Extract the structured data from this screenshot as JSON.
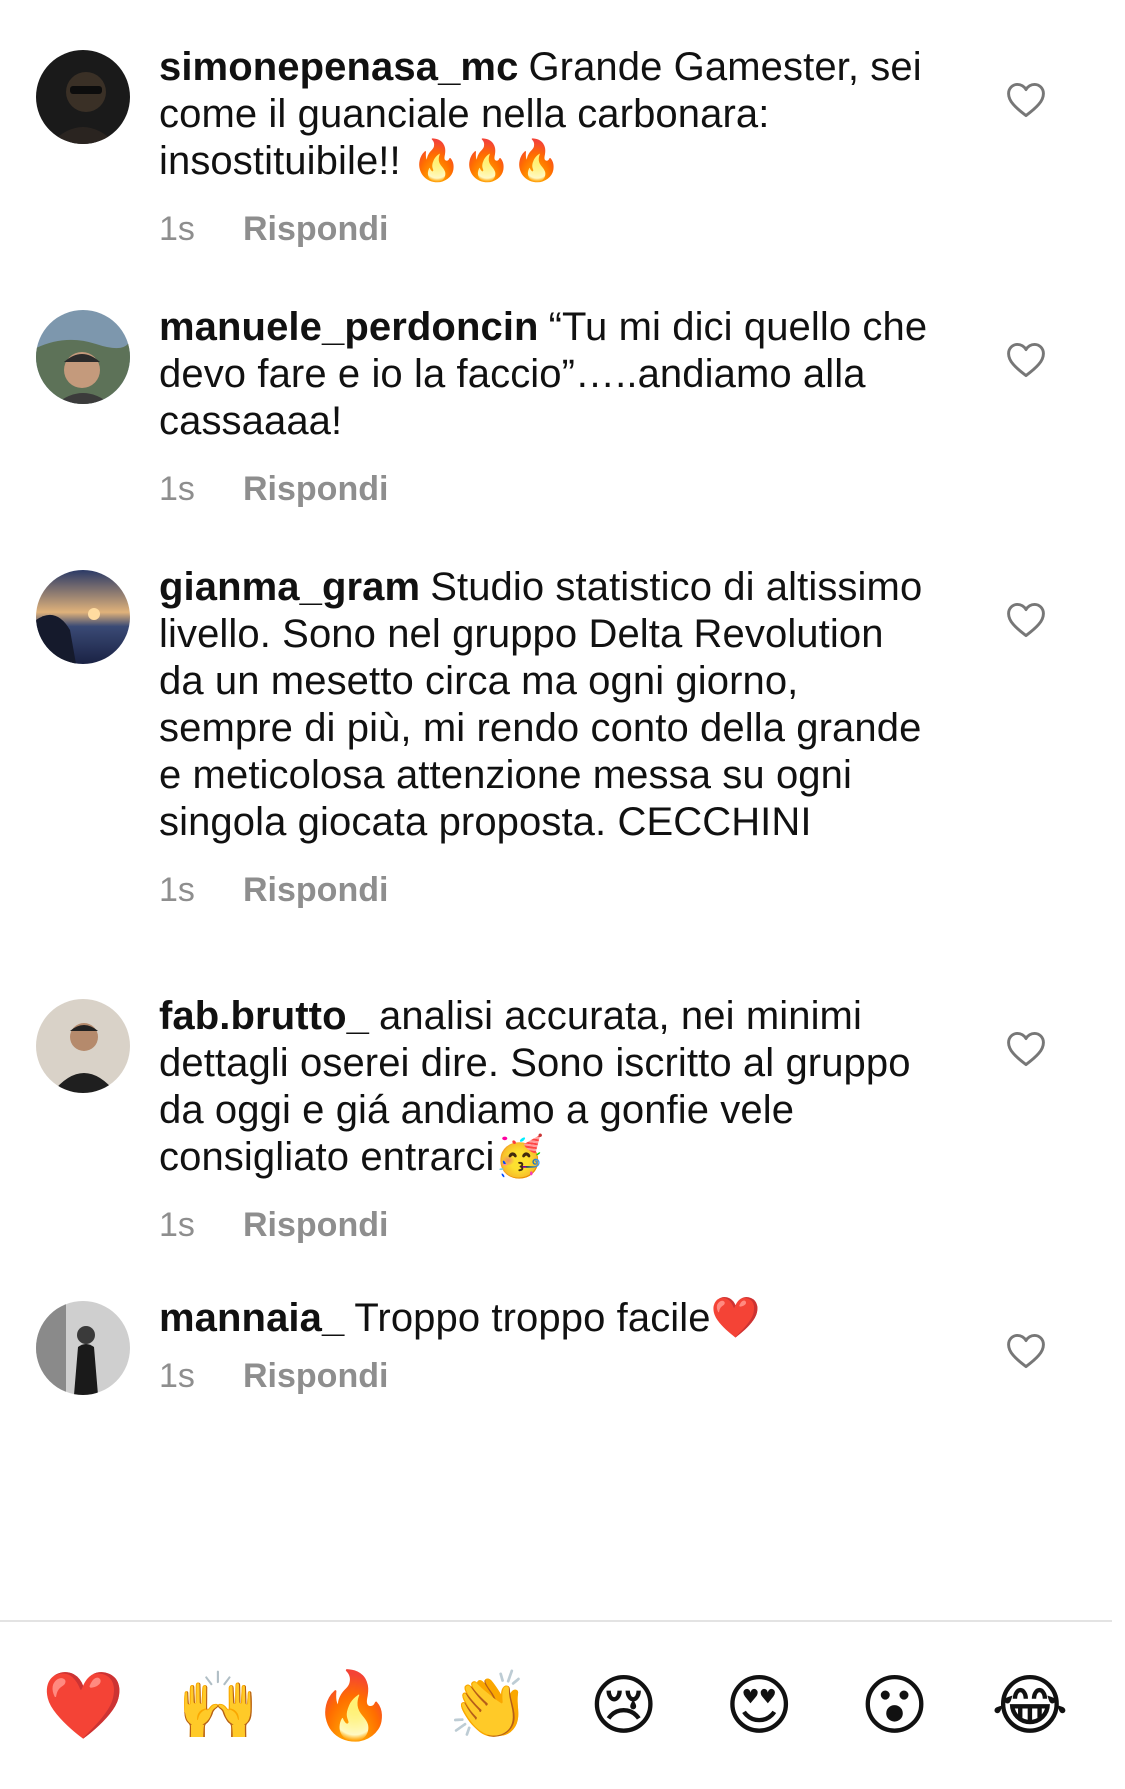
{
  "comments": [
    {
      "username": "simonepenasa_mc",
      "text": "Grande Gamester, sei come il guanciale nella carbonara: insostituibile!! 🔥🔥🔥",
      "time": "1s",
      "reply_label": "Rispondi"
    },
    {
      "username": "manuele_perdoncin",
      "text": "“Tu mi dici quello che devo fare e io la faccio”…..andiamo alla cassaaaa!",
      "time": "1s",
      "reply_label": "Rispondi"
    },
    {
      "username": "gianma_gram",
      "text": "Studio statistico di altissimo livello. Sono nel gruppo Delta Revolution da un mesetto circa ma ogni giorno, sempre di più, mi rendo conto della grande e meticolosa attenzione messa su ogni singola giocata proposta. CECCHINI",
      "time": "1s",
      "reply_label": "Rispondi"
    },
    {
      "username": "fab.brutto_",
      "text": "analisi accurata, nei minimi dettagli oserei dire. Sono iscritto al gruppo da oggi e giá andiamo a gonfie vele consigliato entrarci🥳",
      "time": "1s",
      "reply_label": "Rispondi"
    },
    {
      "username": "mannaia_",
      "text": "Troppo troppo facile❤️",
      "time": "1s",
      "reply_label": "Rispondi"
    }
  ],
  "reactions": [
    {
      "emoji": "❤️",
      "name": "red-heart"
    },
    {
      "emoji": "🙌",
      "name": "raising-hands"
    },
    {
      "emoji": "🔥",
      "name": "fire"
    },
    {
      "emoji": "👏",
      "name": "clapping-hands"
    },
    {
      "emoji": "😢",
      "name": "crying-face"
    },
    {
      "emoji": "😍",
      "name": "heart-eyes"
    },
    {
      "emoji": "😮",
      "name": "surprised-face"
    },
    {
      "emoji": "😂",
      "name": "tears-of-joy"
    }
  ],
  "colors": {
    "text": "#111111",
    "meta": "#8e8e8e",
    "divider": "#e3e3e3"
  }
}
